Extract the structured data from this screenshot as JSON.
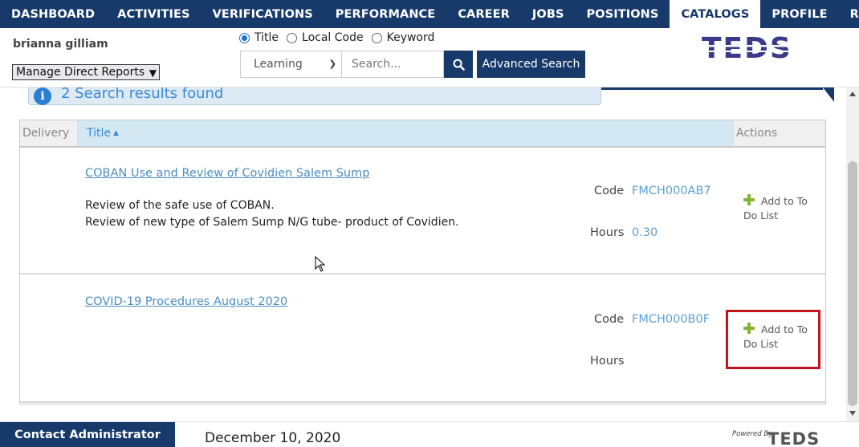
{
  "nav": {
    "items": [
      {
        "label": "DASHBOARD",
        "active": false
      },
      {
        "label": "ACTIVITIES",
        "active": false
      },
      {
        "label": "VERIFICATIONS",
        "active": false
      },
      {
        "label": "PERFORMANCE",
        "active": false
      },
      {
        "label": "CAREER",
        "active": false
      },
      {
        "label": "JOBS",
        "active": false
      },
      {
        "label": "POSITIONS",
        "active": false
      },
      {
        "label": "CATALOGS",
        "active": true
      },
      {
        "label": "PROFILE",
        "active": false
      },
      {
        "label": "RE",
        "active": false
      }
    ]
  },
  "header": {
    "user_name": "brianna gilliam",
    "reports_select": "Manage Direct Reports",
    "search_modes": [
      {
        "label": "Title",
        "checked": true
      },
      {
        "label": "Local Code",
        "checked": false
      },
      {
        "label": "Keyword",
        "checked": false
      }
    ],
    "category_select": "Learning",
    "search_placeholder": "Search...",
    "advanced_search_label": "Advanced Search",
    "logo_text": "TEDS"
  },
  "results": {
    "summary": "2 Search results found",
    "columns": {
      "delivery": "Delivery",
      "title": "Title",
      "actions": "Actions"
    },
    "code_label": "Code",
    "hours_label": "Hours",
    "rows": [
      {
        "title": "COBAN Use and Review of Covidien Salem Sump",
        "description": [
          "Review of the safe use of COBAN.",
          "Review of new type of Salem Sump N/G tube- product of Covidien."
        ],
        "code": "FMCH000AB7",
        "hours": "0.30",
        "action": "Add to To Do List"
      },
      {
        "title": "COVID-19 Procedures August 2020",
        "description": [],
        "code": "FMCH000B0F",
        "hours": "",
        "action": "Add to To Do List"
      }
    ]
  },
  "footer": {
    "contact_label": "Contact Administrator",
    "date": "December 10, 2020",
    "powered_by": "Powered By",
    "powered_logo": "TEDS"
  },
  "colors": {
    "brand_navy": "#173a6b",
    "link_blue": "#4a8ec2",
    "highlight_red": "#c0151d",
    "add_green": "#7cb82f"
  }
}
